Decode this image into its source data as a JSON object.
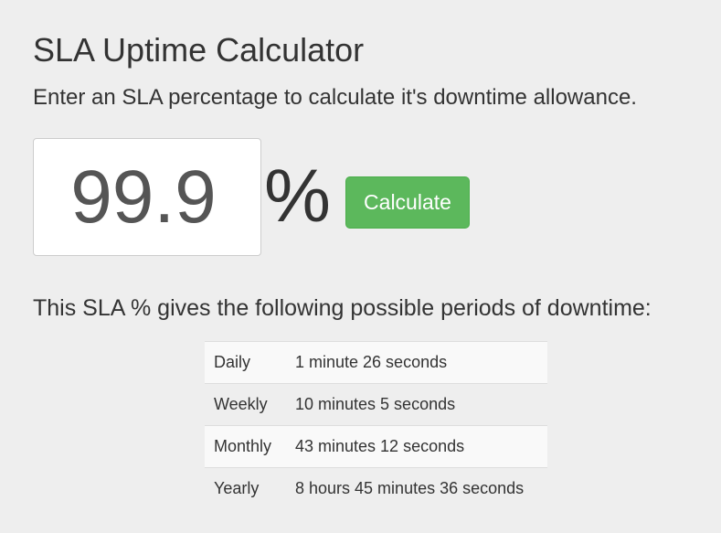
{
  "header": {
    "title": "SLA Uptime Calculator",
    "subtitle": "Enter an SLA percentage to calculate it's downtime allowance."
  },
  "form": {
    "sla_value": "99.9",
    "percent_symbol": "%",
    "calculate_label": "Calculate",
    "button_color": "#5cb85c"
  },
  "results": {
    "heading": "This SLA % gives the following possible periods of downtime:",
    "rows": [
      {
        "period": "Daily",
        "downtime": "1 minute 26 seconds"
      },
      {
        "period": "Weekly",
        "downtime": "10 minutes 5 seconds"
      },
      {
        "period": "Monthly",
        "downtime": "43 minutes 12 seconds"
      },
      {
        "period": "Yearly",
        "downtime": "8 hours 45 minutes 36 seconds"
      }
    ]
  }
}
